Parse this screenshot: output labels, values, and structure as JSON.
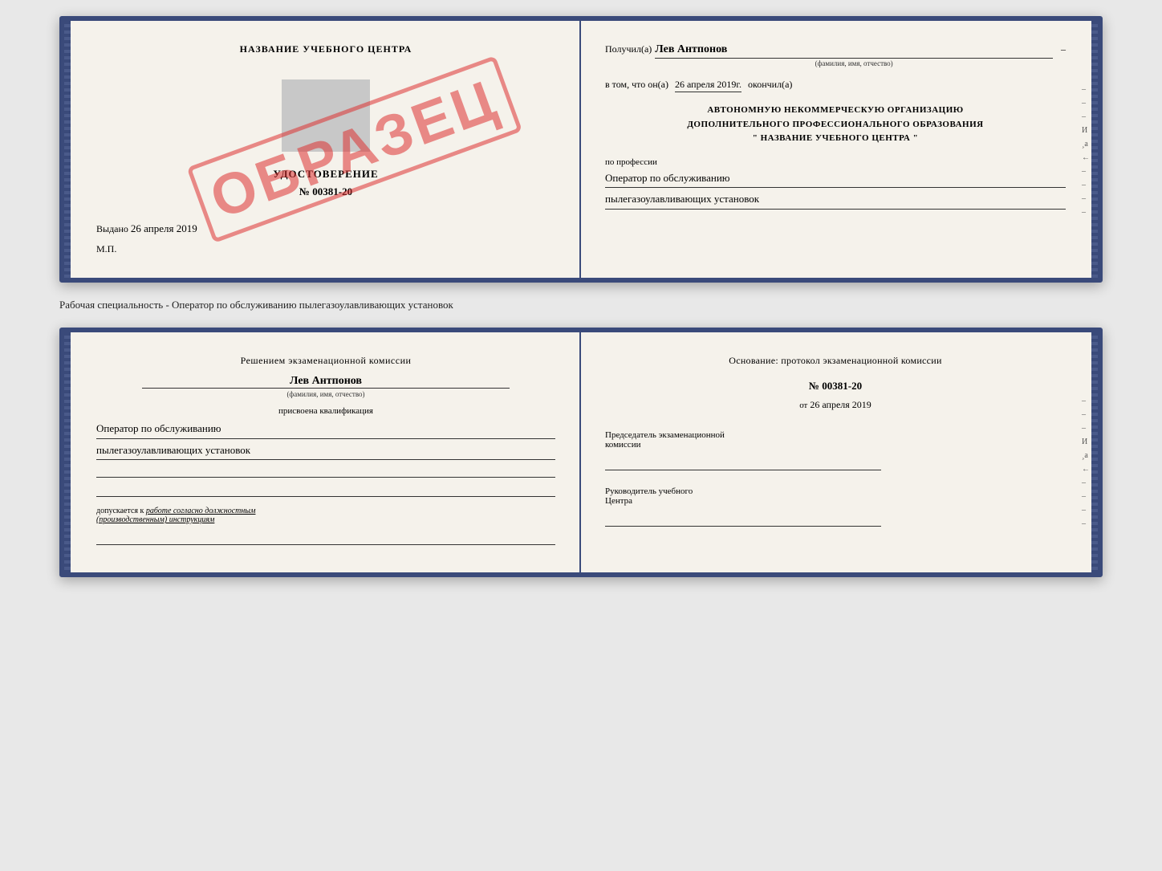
{
  "top_book": {
    "left": {
      "center_title": "НАЗВАНИЕ УЧЕБНОГО ЦЕНТРА",
      "doc_title": "УДОСТОВЕРЕНИЕ",
      "doc_number": "№ 00381-20",
      "issued_label": "Выдано",
      "issued_date": "26 апреля 2019",
      "mp_label": "М.П.",
      "stamp_text": "ОБРАЗЕЦ"
    },
    "right": {
      "received_label": "Получил(а)",
      "recipient_name": "Лев Антпонов",
      "name_hint": "(фамилия, имя, отчество)",
      "date_prefix": "в том, что он(а)",
      "date_value": "26 апреля 2019г.",
      "date_suffix": "окончил(а)",
      "org_line1": "АВТОНОМНУЮ НЕКОММЕРЧЕСКУЮ ОРГАНИЗАЦИЮ",
      "org_line2": "ДОПОЛНИТЕЛЬНОГО ПРОФЕССИОНАЛЬНОГО ОБРАЗОВАНИЯ",
      "org_name": "\" НАЗВАНИЕ УЧЕБНОГО ЦЕНТРА \"",
      "profession_label": "по профессии",
      "profession_line1": "Оператор по обслуживанию",
      "profession_line2": "пылегазоулавливающих установок",
      "side_marks": [
        "–",
        "–",
        "–",
        "И",
        "¸а",
        "←",
        "–",
        "–",
        "–",
        "–"
      ]
    }
  },
  "separator": {
    "text": "Рабочая специальность - Оператор по обслуживанию пылегазоулавливающих установок"
  },
  "bottom_book": {
    "left": {
      "decision_text": "Решением экзаменационной комиссии",
      "person_name": "Лев Антпонов",
      "name_hint": "(фамилия, имя, отчество)",
      "qualification_label": "присвоена квалификация",
      "qualification_line1": "Оператор по обслуживанию",
      "qualification_line2": "пылегазоулавливающих установок",
      "допускается_prefix": "допускается к",
      "допускается_value": "работе согласно должностным",
      "производственным": "(производственным) инструкциям"
    },
    "right": {
      "osnov_label": "Основание: протокол экзаменационной комиссии",
      "protocol_number": "№ 00381-20",
      "protocol_date_prefix": "от",
      "protocol_date_value": "26 апреля 2019",
      "chairman_label": "Председатель экзаменационной",
      "chairman_label2": "комиссии",
      "director_label": "Руководитель учебного",
      "director_label2": "Центра",
      "side_marks": [
        "–",
        "–",
        "–",
        "И",
        "¸а",
        "←",
        "–",
        "–",
        "–",
        "–"
      ]
    }
  }
}
